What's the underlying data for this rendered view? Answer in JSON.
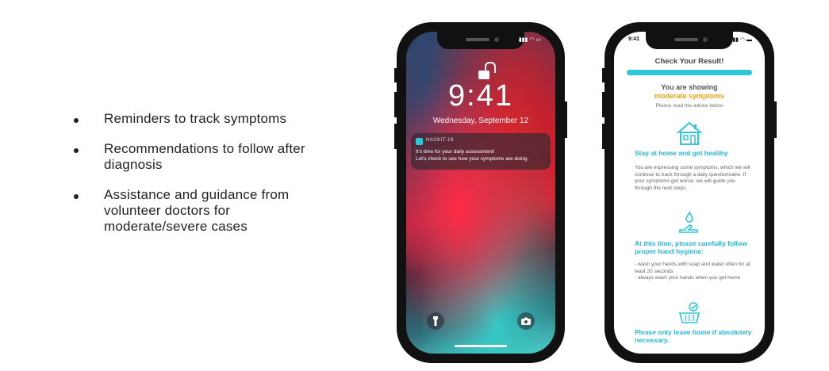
{
  "bullets": [
    "Reminders to track symptoms",
    "Recommendations to follow after diagnosis",
    "Assistance and guidance from volunteer doctors for moderate/severe cases"
  ],
  "lock_screen": {
    "time": "9:41",
    "date": "Wednesday, September 12",
    "notification": {
      "app_name": "HACKIT-19",
      "line1": "It's time for your daily assessment!",
      "line2": "Let's check to see how your symptoms are doing."
    },
    "icons": [
      "lock-icon",
      "flashlight-icon",
      "camera-icon"
    ]
  },
  "result_screen": {
    "status_time": "9:41",
    "title": "Check Your Result!",
    "showing_line": "You are showing",
    "severity": "moderate symptoms",
    "read_advice": "Please read the advice below",
    "sections": [
      {
        "icon": "house-icon",
        "heading": "Stay at home and get healthy",
        "body": "You are expressing some symptoms, which we will continue to track through a daily questionnaire. If your symptoms get worse, we will guide you through the next steps."
      },
      {
        "icon": "hand-wash-icon",
        "heading": "At this time, please carefully follow proper hand hygiene:",
        "body": "- wash your hands with soap and water often for at least 20 seconds\n- always wash your hands when you get home"
      },
      {
        "icon": "basket-icon",
        "heading": "Please only leave home if absolutely necessary.",
        "body": ""
      }
    ]
  },
  "colors": {
    "accent": "#2ec6d9",
    "heading": "#2bb7d3",
    "severity": "#f0a21b"
  }
}
